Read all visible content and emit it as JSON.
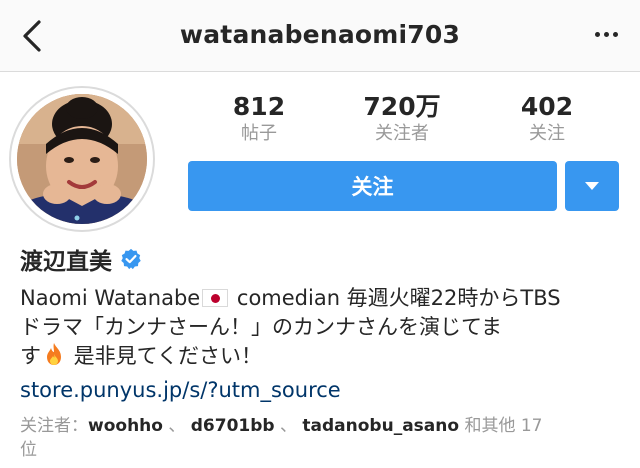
{
  "header": {
    "username": "watanabenaomi703",
    "back_icon": "chevron-left-icon",
    "more_icon": "ellipsis-icon"
  },
  "stats": {
    "posts": {
      "value": "812",
      "label": "帖子"
    },
    "followers": {
      "value": "720万",
      "label": "关注者"
    },
    "following": {
      "value": "402",
      "label": "关注"
    }
  },
  "actions": {
    "follow_label": "关注",
    "dropdown_icon": "caret-down-icon",
    "button_color": "#3897f0"
  },
  "profile": {
    "display_name": "渡辺直美",
    "verified": true,
    "bio_line1_a": "Naomi Watanabe",
    "bio_line1_b": " comedian 毎週火曜22時からTBS",
    "bio_line2": "ドラマ「カンナさーん！」のカンナさんを演じてま",
    "bio_line3_a": "す",
    "bio_line3_b": " 是非見てください！",
    "link": "store.punyus.jp/s/?utm_source"
  },
  "followed_by": {
    "prefix": "关注者：",
    "users": [
      "woohho",
      "d6701bb",
      "tadanobu_asano"
    ],
    "separator": " 、 ",
    "suffix": " 和其他 17",
    "suffix_line2": "位"
  }
}
